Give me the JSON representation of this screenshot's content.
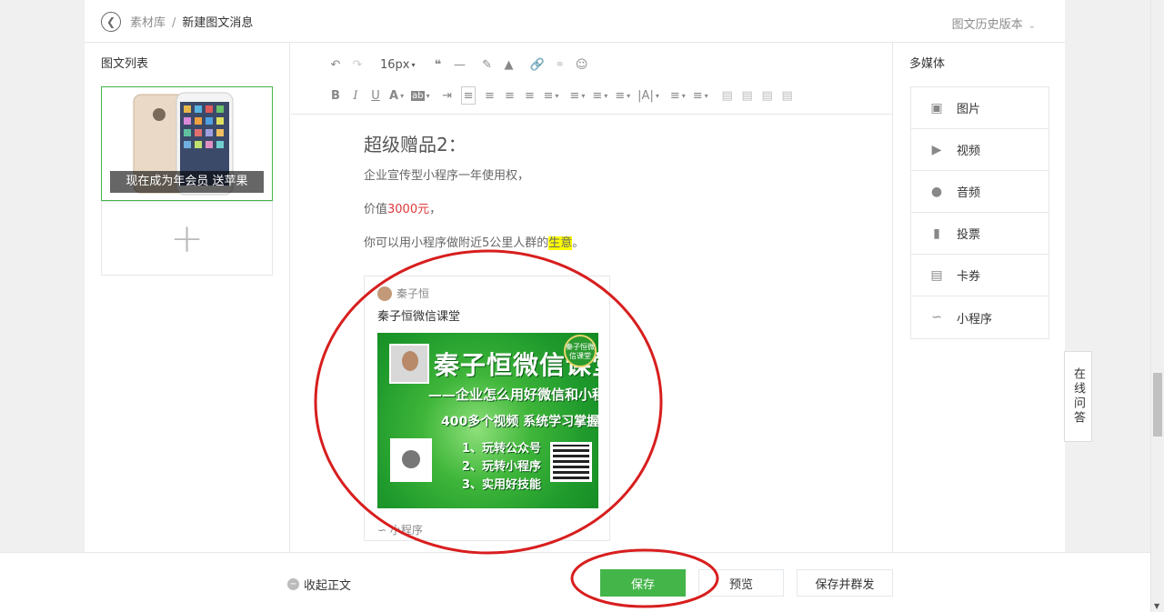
{
  "header": {
    "breadcrumb_root": "素材库",
    "breadcrumb_sep": "/",
    "breadcrumb_current": "新建图文消息",
    "history_label": "图文历史版本"
  },
  "left_panel": {
    "title": "图文列表",
    "card_caption": "现在成为年会员 送苹果"
  },
  "toolbar": {
    "font_size": "16px"
  },
  "content": {
    "heading": "超级赠品2：",
    "p1": "企业宣传型小程序一年使用权，",
    "p2_prefix": "价值",
    "p2_red": "3000元",
    "p2_suffix": "，",
    "p3_prefix": "你可以用小程序做附近5公里人群的",
    "p3_highlight": "生意",
    "p3_suffix": "。"
  },
  "mini_program_card": {
    "author": "秦子恒",
    "title": "秦子恒微信课堂",
    "banner_title": "秦子恒微信课堂",
    "banner_sub": "——企业怎么用好微信和小程序",
    "banner_sub2": "400多个视频 系统学习掌握",
    "banner_items": [
      "1、玩转公众号",
      "2、玩转小程序",
      "3、实用好技能"
    ],
    "badge": "秦子恒微信课堂",
    "footer": "小程序"
  },
  "right_panel": {
    "title": "多媒体",
    "items": [
      {
        "label": "图片",
        "icon": "image-icon"
      },
      {
        "label": "视频",
        "icon": "video-icon"
      },
      {
        "label": "音频",
        "icon": "audio-icon"
      },
      {
        "label": "投票",
        "icon": "vote-icon"
      },
      {
        "label": "卡券",
        "icon": "coupon-icon"
      },
      {
        "label": "小程序",
        "icon": "miniprogram-icon"
      }
    ]
  },
  "online_qa": "在线问答",
  "footer": {
    "collapse_label": "收起正文",
    "save_label": "保存",
    "preview_label": "预览",
    "publish_label": "保存并群发"
  },
  "colors": {
    "primary_green": "#44b549",
    "annotation_red": "#d81e1e",
    "highlight": "#ffff00",
    "price_red": "#e0383a"
  }
}
